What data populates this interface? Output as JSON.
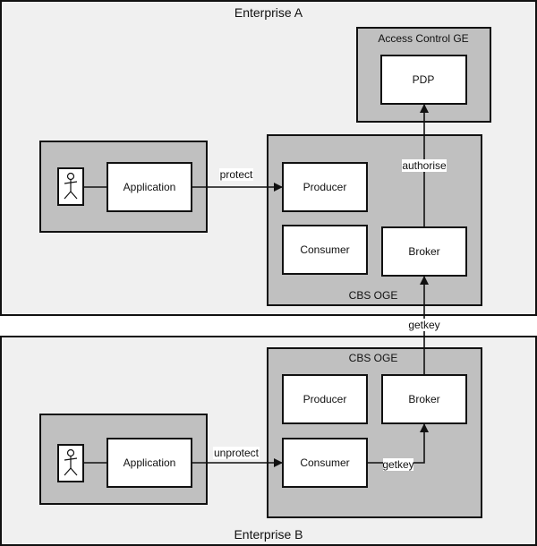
{
  "enterprise_a": {
    "title": "Enterprise A",
    "access_control": {
      "title": "Access Control GE",
      "pdp": "PDP"
    },
    "cbs": {
      "title": "CBS OGE",
      "producer": "Producer",
      "consumer": "Consumer",
      "broker": "Broker"
    },
    "application": "Application",
    "edge_protect": "protect",
    "edge_authorise": "authorise"
  },
  "edge_getkey_cross": "getkey",
  "enterprise_b": {
    "title": "Enterprise B",
    "cbs": {
      "title": "CBS OGE",
      "producer": "Producer",
      "consumer": "Consumer",
      "broker": "Broker"
    },
    "application": "Application",
    "edge_unprotect": "unprotect",
    "edge_getkey": "getkey"
  },
  "colors": {
    "enterprise_bg": "#f0f0f0",
    "group_bg": "#c0c0c0",
    "box_bg": "#ffffff"
  },
  "icons": [
    "actor-icon"
  ]
}
